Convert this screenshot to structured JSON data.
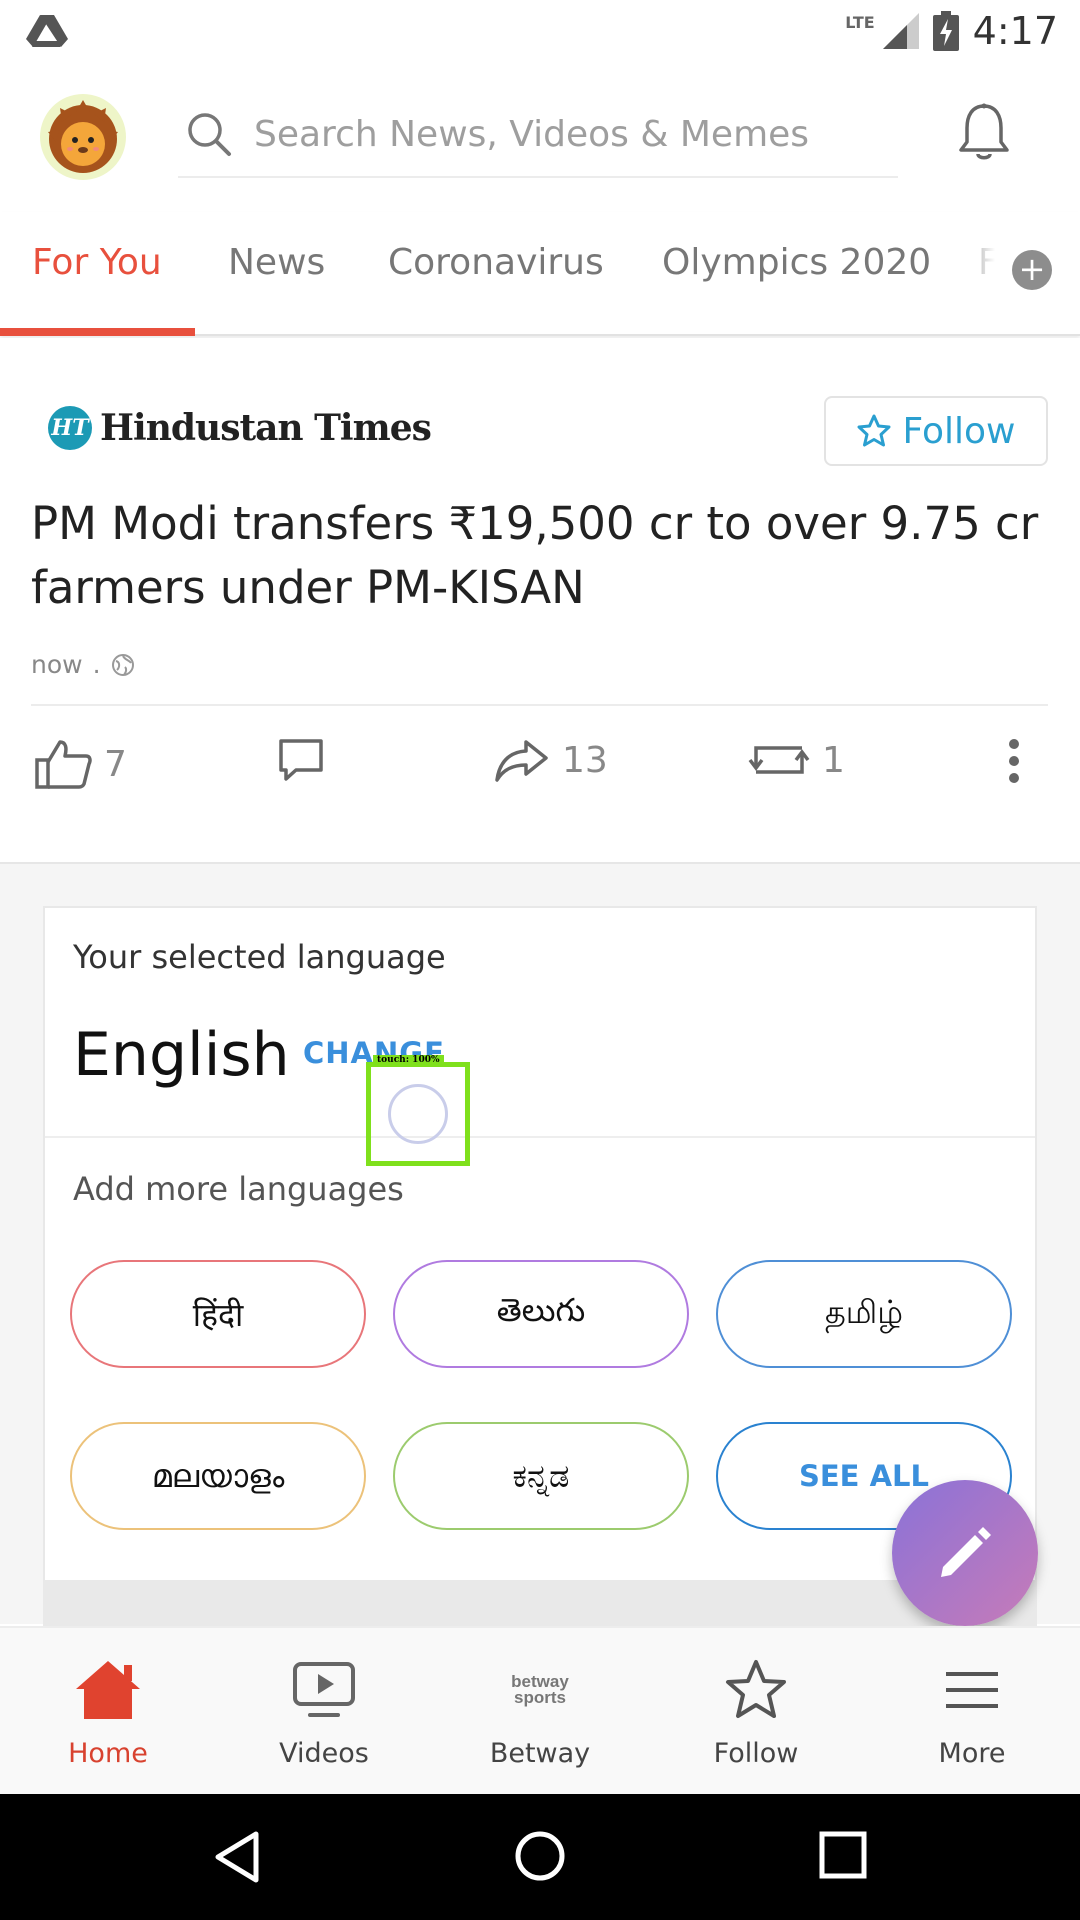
{
  "status_bar": {
    "network": "LTE",
    "time": "4:17"
  },
  "header": {
    "search": {
      "placeholder": "Search News, Videos & Memes"
    }
  },
  "tabs": [
    {
      "label": "For You",
      "active": true
    },
    {
      "label": "News"
    },
    {
      "label": "Coronavirus"
    },
    {
      "label": "Olympics 2020"
    },
    {
      "label": "F"
    }
  ],
  "tabs_more": "+",
  "article": {
    "publisher_badge": "HT",
    "publisher": "Hindustan Times",
    "follow_label": "Follow",
    "headline": "PM Modi transfers ₹19,500 cr to over 9.75 cr farmers under PM-KISAN",
    "time": "now",
    "meta_separator": ".",
    "likes": "7",
    "shares": "13",
    "reposts": "1"
  },
  "language_card": {
    "selected_label": "Your selected language",
    "selected_value": "English",
    "change_label": "CHANGE",
    "add_label": "Add more languages",
    "languages": [
      {
        "label": "हिंदी",
        "color": "#e8767a"
      },
      {
        "label": "తెలుగు",
        "color": "#b07be0"
      },
      {
        "label": "தமிழ்",
        "color": "#4f8fd6"
      },
      {
        "label": "മലയാളം",
        "color": "#ecc27a"
      },
      {
        "label": "ಕನ್ನಡ",
        "color": "#9ccb6e"
      }
    ],
    "see_all_label": "SEE ALL"
  },
  "touch_overlay": {
    "label": "touch: 100%"
  },
  "bottom_nav": [
    {
      "label": "Home",
      "icon": "home-icon",
      "active": true
    },
    {
      "label": "Videos",
      "icon": "video-icon"
    },
    {
      "label": "Betway",
      "icon": "betway-logo"
    },
    {
      "label": "Follow",
      "icon": "star-icon"
    },
    {
      "label": "More",
      "icon": "menu-icon"
    }
  ],
  "betway_logo_text": {
    "line1": "betway",
    "line2": "sports"
  },
  "colors": {
    "accent": "#e8503d",
    "link_blue": "#2a9fd0",
    "fab_start": "#8a72d8",
    "fab_end": "#c77bb8"
  }
}
